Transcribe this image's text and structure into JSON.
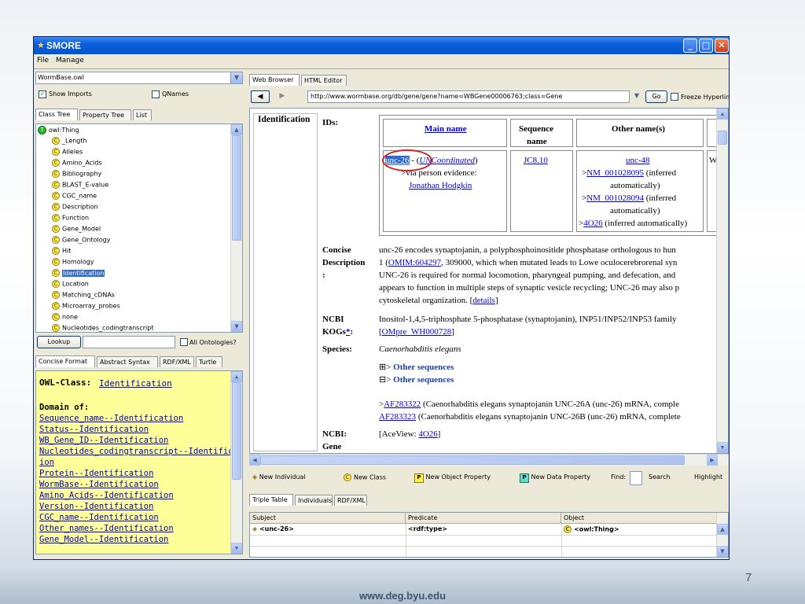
{
  "window": {
    "title": "SMORE"
  },
  "menu": [
    "File",
    "Manage"
  ],
  "left_panel": {
    "ontology_combo": "WormBase.owl",
    "show_imports": "Show Imports",
    "qnames": "QNames",
    "tabs": [
      "Class Tree",
      "Property Tree",
      "List"
    ],
    "tree_root": "owl:Thing",
    "tree_items": [
      "_Length",
      "Alleles",
      "Amino_Acids",
      "Bibliography",
      "BLAST_E-value",
      "CGC_name",
      "Description",
      "Function",
      "Gene_Model",
      "Gene_Ontology",
      "Hit",
      "Homology",
      "Identification",
      "Location",
      "Matching_cDNAs",
      "Microarray_probes",
      "none",
      "Nucleotides_codingtranscript"
    ],
    "lookup_button": "Lookup",
    "all_ontologies": "All Ontologies?",
    "format_tabs": [
      "Concise Format",
      "Abstract Syntax",
      "RDF/XML",
      "Turtle"
    ],
    "owl_class_label": "OWL-Class:",
    "owl_class_value": "Identification",
    "domain_of": "Domain of:",
    "domain_items": [
      "Sequence_name--Identification",
      "Status--Identification",
      "WB_Gene_ID--Identification",
      "Nucleotides_codingtranscript--Identificat",
      "ion",
      "Protein--Identification",
      "WormBase--Identification",
      "Amino_Acids--Identification",
      "Version--Identification",
      "CGC_name--Identification",
      "Other_names--Identification",
      "Gene_Model--Identification"
    ]
  },
  "right_panel": {
    "tabs": [
      "Web Browser",
      "HTML Editor"
    ],
    "url": "http://www.wormbase.org/db/gene/gene?name=WBGene00006763;class=Gene",
    "go": "Go",
    "freeze": "Freeze Hyperlinks",
    "page": {
      "section": "Identification",
      "ids_label": "IDs:",
      "headers": {
        "main_name": "Main name",
        "sequence_name_1": "Sequence",
        "sequence_name_2": "name",
        "other_names": "Other name(s)"
      },
      "main_name_link": "unc-26",
      "main_name_rest": " - (",
      "main_name_paren": "UNCoordinated",
      "main_name_close": ")",
      "via_person": ">via person evidence:",
      "person": "Jonathan Hodgkin",
      "sequence": "JC8.10",
      "other_names": {
        "l1": "unc-48",
        "l2a": ">",
        "l2b": "NM_001028095",
        "l2c": " (inferred",
        "l3": "automatically)",
        "l4a": ">",
        "l4b": "NM_001028094",
        "l4c": " (inferred",
        "l5": "automatically)",
        "l6a": ">",
        "l6b": "4O26",
        "l6c": " (inferred automatically)"
      },
      "w_cut": "W",
      "concise_label_1": "Concise",
      "concise_label_2": "Description",
      "concise_label_3": ":",
      "concise_l1": "unc-26 encodes synaptojanin, a polyphosphoinositide phosphatase orthologous to hun",
      "concise_l2a": "1 (",
      "concise_l2b": "OMIM:604297",
      "concise_l2c": ", 309000, which when mutated leads to Lowe oculocerebrorenal syn",
      "concise_l3": "UNC-26 is required for normal locomotion, pharyngeal pumping, and defecation, and",
      "concise_l4": "appears to function in multiple steps of synaptic vesicle recycling; UNC-26 may also p",
      "concise_l5a": "cytoskeletal organization. [",
      "concise_l5b": "details",
      "concise_l5c": "]",
      "ncbi_kogs_1": "NCBI",
      "ncbi_kogs_2": "KOGs",
      "ncbi_kogs_star": "*",
      "ncbi_kogs_colon": ":",
      "kogs_l1": "Inositol-1,4,5-triphosphate 5-phosphatase (synaptojanin), INP51/INP52/INP53 family",
      "kogs_l2a": "[",
      "kogs_l2b": "OMpre_WH000728",
      "kogs_l2c": "]",
      "species_label": "Species:",
      "species": "Caenorhabditis elegans",
      "other_seq_1": "Other sequences",
      "other_seq_2": "Other sequences",
      "af1a": ">",
      "af1b": "AF283322",
      "af1c": " (Caenorhabditis elegans synaptojanin UNC-26A (unc-26) mRNA, comple",
      "af2b": "AF283323",
      "af2c": " (Caenorhabditis elegans synaptojanin UNC-26B (unc-26) mRNA, complete",
      "ncbi_label": "NCBI:",
      "aceview_a": "[AceView: ",
      "aceview_b": "4O26",
      "aceview_c": "]",
      "gene_label": "Gene"
    },
    "toolbar": [
      "New Individual",
      "New Class",
      "New Object Property",
      "New Data Property",
      "Find:",
      "Search",
      "Highlight"
    ],
    "bottom_tabs": [
      "Triple Table",
      "Individuals",
      "RDF/XML"
    ],
    "triple_headers": [
      "Subject",
      "Predicate",
      "Object"
    ],
    "triple_row": [
      "<unc-26>",
      "<rdf:type>",
      "<owl:Thing>"
    ]
  },
  "slide": {
    "footer": "www.deg.byu.edu",
    "number": "7"
  }
}
